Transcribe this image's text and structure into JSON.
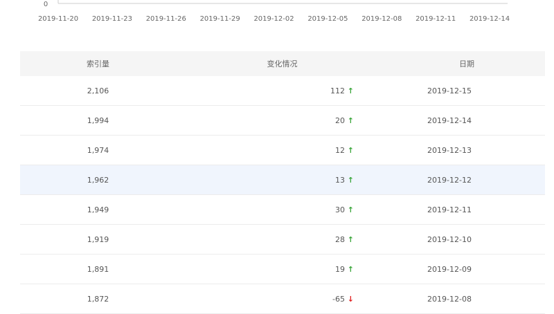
{
  "chart_data": {
    "type": "line",
    "y_zero_label": "0",
    "x_tick_labels": [
      "2019-11-20",
      "2019-11-23",
      "2019-11-26",
      "2019-11-29",
      "2019-12-02",
      "2019-12-05",
      "2019-12-08",
      "2019-12-11",
      "2019-12-14"
    ]
  },
  "table": {
    "headers": [
      "索引量",
      "变化情况",
      "日期"
    ],
    "rows": [
      {
        "index": "2,106",
        "change": "112",
        "dir": "up",
        "date": "2019-12-15"
      },
      {
        "index": "1,994",
        "change": "20",
        "dir": "up",
        "date": "2019-12-14"
      },
      {
        "index": "1,974",
        "change": "12",
        "dir": "up",
        "date": "2019-12-13"
      },
      {
        "index": "1,962",
        "change": "13",
        "dir": "up",
        "date": "2019-12-12"
      },
      {
        "index": "1,949",
        "change": "30",
        "dir": "up",
        "date": "2019-12-11"
      },
      {
        "index": "1,919",
        "change": "28",
        "dir": "up",
        "date": "2019-12-10"
      },
      {
        "index": "1,891",
        "change": "19",
        "dir": "up",
        "date": "2019-12-09"
      },
      {
        "index": "1,872",
        "change": "-65",
        "dir": "down",
        "date": "2019-12-08"
      }
    ],
    "highlight_row": 3,
    "colors": {
      "up": "#3aa63a",
      "down": "#e02020",
      "highlight": "#f0f5fd"
    }
  }
}
